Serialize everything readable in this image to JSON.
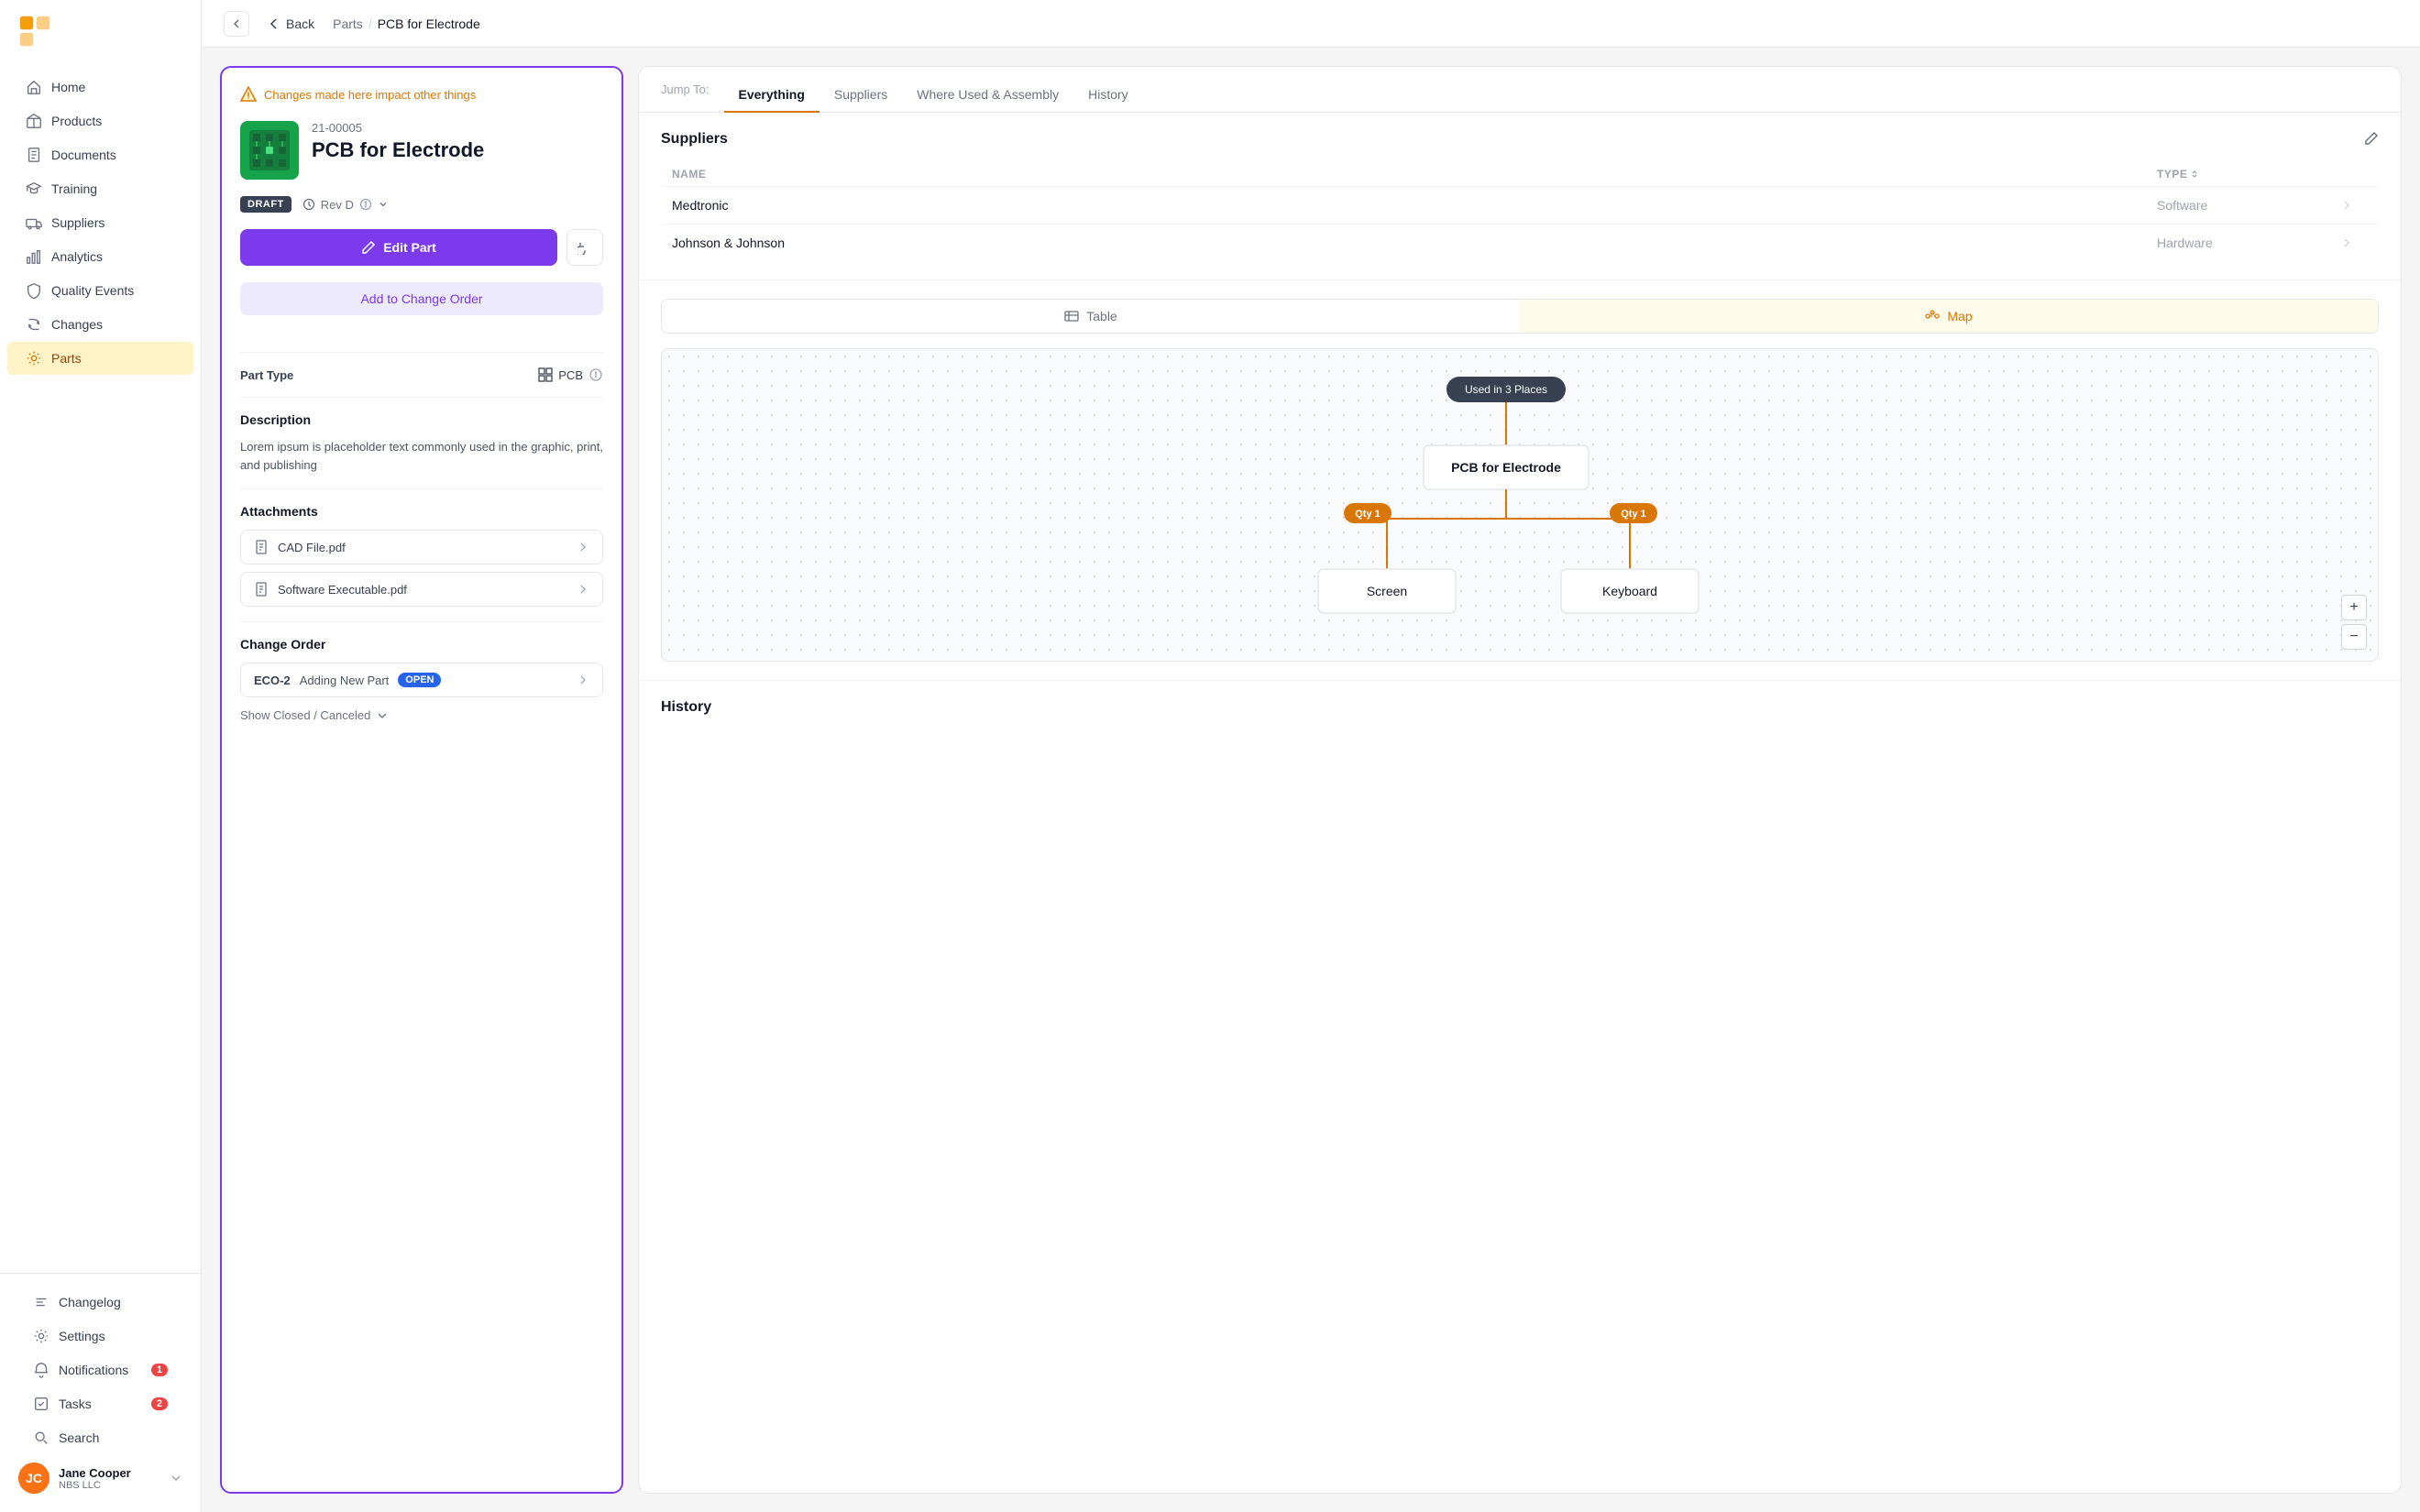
{
  "sidebar": {
    "nav_items": [
      {
        "id": "home",
        "label": "Home",
        "icon": "home",
        "active": false
      },
      {
        "id": "products",
        "label": "Products",
        "icon": "box",
        "active": false
      },
      {
        "id": "documents",
        "label": "Documents",
        "icon": "file",
        "active": false
      },
      {
        "id": "training",
        "label": "Training",
        "icon": "graduation",
        "active": false
      },
      {
        "id": "suppliers",
        "label": "Suppliers",
        "icon": "truck",
        "active": false
      },
      {
        "id": "analytics",
        "label": "Analytics",
        "icon": "bar-chart",
        "active": false
      },
      {
        "id": "quality-events",
        "label": "Quality Events",
        "icon": "shield",
        "active": false
      },
      {
        "id": "changes",
        "label": "Changes",
        "icon": "refresh",
        "active": false
      },
      {
        "id": "parts",
        "label": "Parts",
        "icon": "gear",
        "active": true
      }
    ],
    "bottom_items": [
      {
        "id": "changelog",
        "label": "Changelog",
        "icon": "list"
      },
      {
        "id": "settings",
        "label": "Settings",
        "icon": "settings"
      },
      {
        "id": "notifications",
        "label": "Notifications",
        "icon": "bell",
        "badge": 1
      },
      {
        "id": "tasks",
        "label": "Tasks",
        "icon": "check",
        "badge": 2
      },
      {
        "id": "search",
        "label": "Search",
        "icon": "search"
      }
    ],
    "user": {
      "name": "Jane Cooper",
      "company": "NBS LLC"
    }
  },
  "breadcrumb": {
    "back_label": "Back",
    "parent": "Parts",
    "current": "PCB for Electrode"
  },
  "left_panel": {
    "warning_text": "Changes made here impact other things",
    "part_number": "21-00005",
    "part_name": "PCB for Electrode",
    "status_badge": "DRAFT",
    "revision": "Rev D",
    "edit_btn_label": "Edit Part",
    "add_to_co_label": "Add to Change Order",
    "part_type_label": "Part Type",
    "part_type_value": "PCB",
    "description_label": "Description",
    "description_text": "Lorem ipsum is placeholder text commonly used in the graphic, print, and publishing",
    "attachments_label": "Attachments",
    "attachments": [
      {
        "name": "CAD File.pdf"
      },
      {
        "name": "Software Executable.pdf"
      }
    ],
    "change_order_label": "Change Order",
    "change_orders": [
      {
        "id": "ECO-2",
        "title": "Adding New Part",
        "status": "OPEN"
      }
    ],
    "show_closed_label": "Show Closed / Canceled"
  },
  "right_panel": {
    "jump_to_label": "Jump To:",
    "tabs": [
      {
        "id": "everything",
        "label": "Everything",
        "active": true
      },
      {
        "id": "suppliers",
        "label": "Suppliers",
        "active": false
      },
      {
        "id": "where-used",
        "label": "Where Used & Assembly",
        "active": false
      },
      {
        "id": "history",
        "label": "History",
        "active": false
      }
    ],
    "suppliers_section": {
      "heading": "Suppliers",
      "col_name": "NAME",
      "col_type": "TYPE",
      "rows": [
        {
          "name": "Medtronic",
          "type": "Software"
        },
        {
          "name": "Johnson & Johnson",
          "type": "Hardware"
        }
      ]
    },
    "map_section": {
      "table_btn": "Table",
      "map_btn": "Map",
      "active_view": "map",
      "badge_text": "Used in 3 Places",
      "node_label": "PCB for Electrode",
      "child_left": "Screen",
      "child_right": "Keyboard",
      "qty_label": "Qty 1"
    },
    "history_section": {
      "heading": "History"
    }
  },
  "colors": {
    "purple": "#7c3aed",
    "amber": "#d97706",
    "blue": "#2563eb",
    "green": "#16a34a"
  }
}
